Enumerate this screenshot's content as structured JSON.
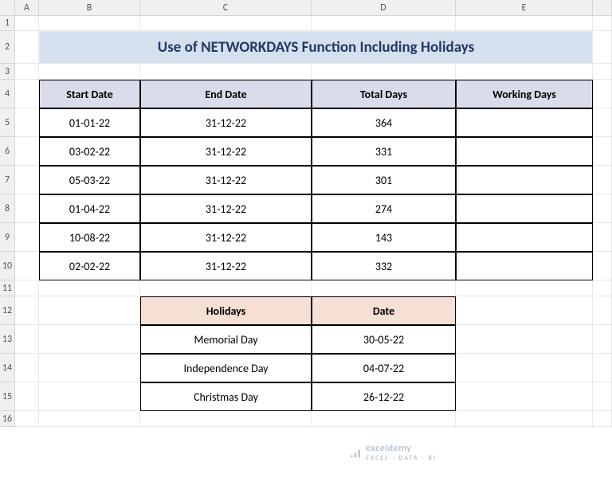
{
  "columns": [
    "A",
    "B",
    "C",
    "D",
    "E"
  ],
  "rows": [
    "1",
    "2",
    "3",
    "4",
    "5",
    "6",
    "7",
    "8",
    "9",
    "10",
    "11",
    "12",
    "13",
    "14",
    "15",
    "16"
  ],
  "title": "Use of NETWORKDAYS Function Including Holidays",
  "table1": {
    "headers": {
      "start": "Start Date",
      "end": "End Date",
      "total": "Total Days",
      "working": "Working Days"
    },
    "rows": [
      {
        "start": "01-01-22",
        "end": "31-12-22",
        "total": "364",
        "working": ""
      },
      {
        "start": "03-02-22",
        "end": "31-12-22",
        "total": "331",
        "working": ""
      },
      {
        "start": "05-03-22",
        "end": "31-12-22",
        "total": "301",
        "working": ""
      },
      {
        "start": "01-04-22",
        "end": "31-12-22",
        "total": "274",
        "working": ""
      },
      {
        "start": "10-08-22",
        "end": "31-12-22",
        "total": "143",
        "working": ""
      },
      {
        "start": "02-02-22",
        "end": "31-12-22",
        "total": "332",
        "working": ""
      }
    ]
  },
  "table2": {
    "headers": {
      "name": "Holidays",
      "date": "Date"
    },
    "rows": [
      {
        "name": "Memorial Day",
        "date": "30-05-22"
      },
      {
        "name": "Independence Day",
        "date": "04-07-22"
      },
      {
        "name": "Christmas Day",
        "date": "26-12-22"
      }
    ]
  },
  "watermark": {
    "brand": "exceldemy",
    "tagline": "EXCEL · DATA · BI"
  }
}
